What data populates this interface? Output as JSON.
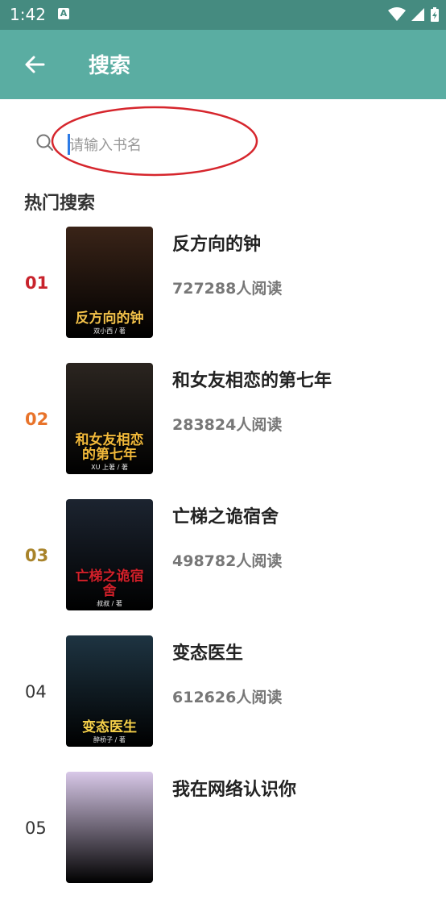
{
  "status_bar": {
    "time": "1:42",
    "a_badge": "A"
  },
  "header": {
    "title": "搜索"
  },
  "search": {
    "placeholder": "请输入书名",
    "value": ""
  },
  "section": {
    "title": "热门搜索"
  },
  "books": [
    {
      "rank": "01",
      "rank_color": "#c8232c",
      "title": "反方向的钟",
      "reads": "727288人阅读",
      "cover_title": "反方向的钟",
      "cover_author": "双小西 / 著",
      "cover_bg": "#3a2418",
      "cover_title_color": "#f4c24a"
    },
    {
      "rank": "02",
      "rank_color": "#e8732a",
      "title": "和女友相恋的第七年",
      "reads": "283824人阅读",
      "cover_title": "和女友相恋的第七年",
      "cover_author": "XU 上著 / 著",
      "cover_bg": "#2b2520",
      "cover_title_color": "#f2b93a"
    },
    {
      "rank": "03",
      "rank_color": "#a8832a",
      "title": "亡梯之诡宿舍",
      "reads": "498782人阅读",
      "cover_title": "亡梯之诡宿舍",
      "cover_author": "叔叔 / 著",
      "cover_bg": "#1c2430",
      "cover_title_color": "#d2202a"
    },
    {
      "rank": "04",
      "rank_color": "#333333",
      "title": "变态医生",
      "reads": "612626人阅读",
      "cover_title": "变态医生",
      "cover_author": "醉桥子 / 著",
      "cover_bg": "#1e3442",
      "cover_title_color": "#f5d04a"
    },
    {
      "rank": "05",
      "rank_color": "#333333",
      "title": "我在网络认识你",
      "reads": "",
      "cover_title": "",
      "cover_author": "",
      "cover_bg": "#d8c8e8",
      "cover_title_color": "#ffffff"
    }
  ]
}
